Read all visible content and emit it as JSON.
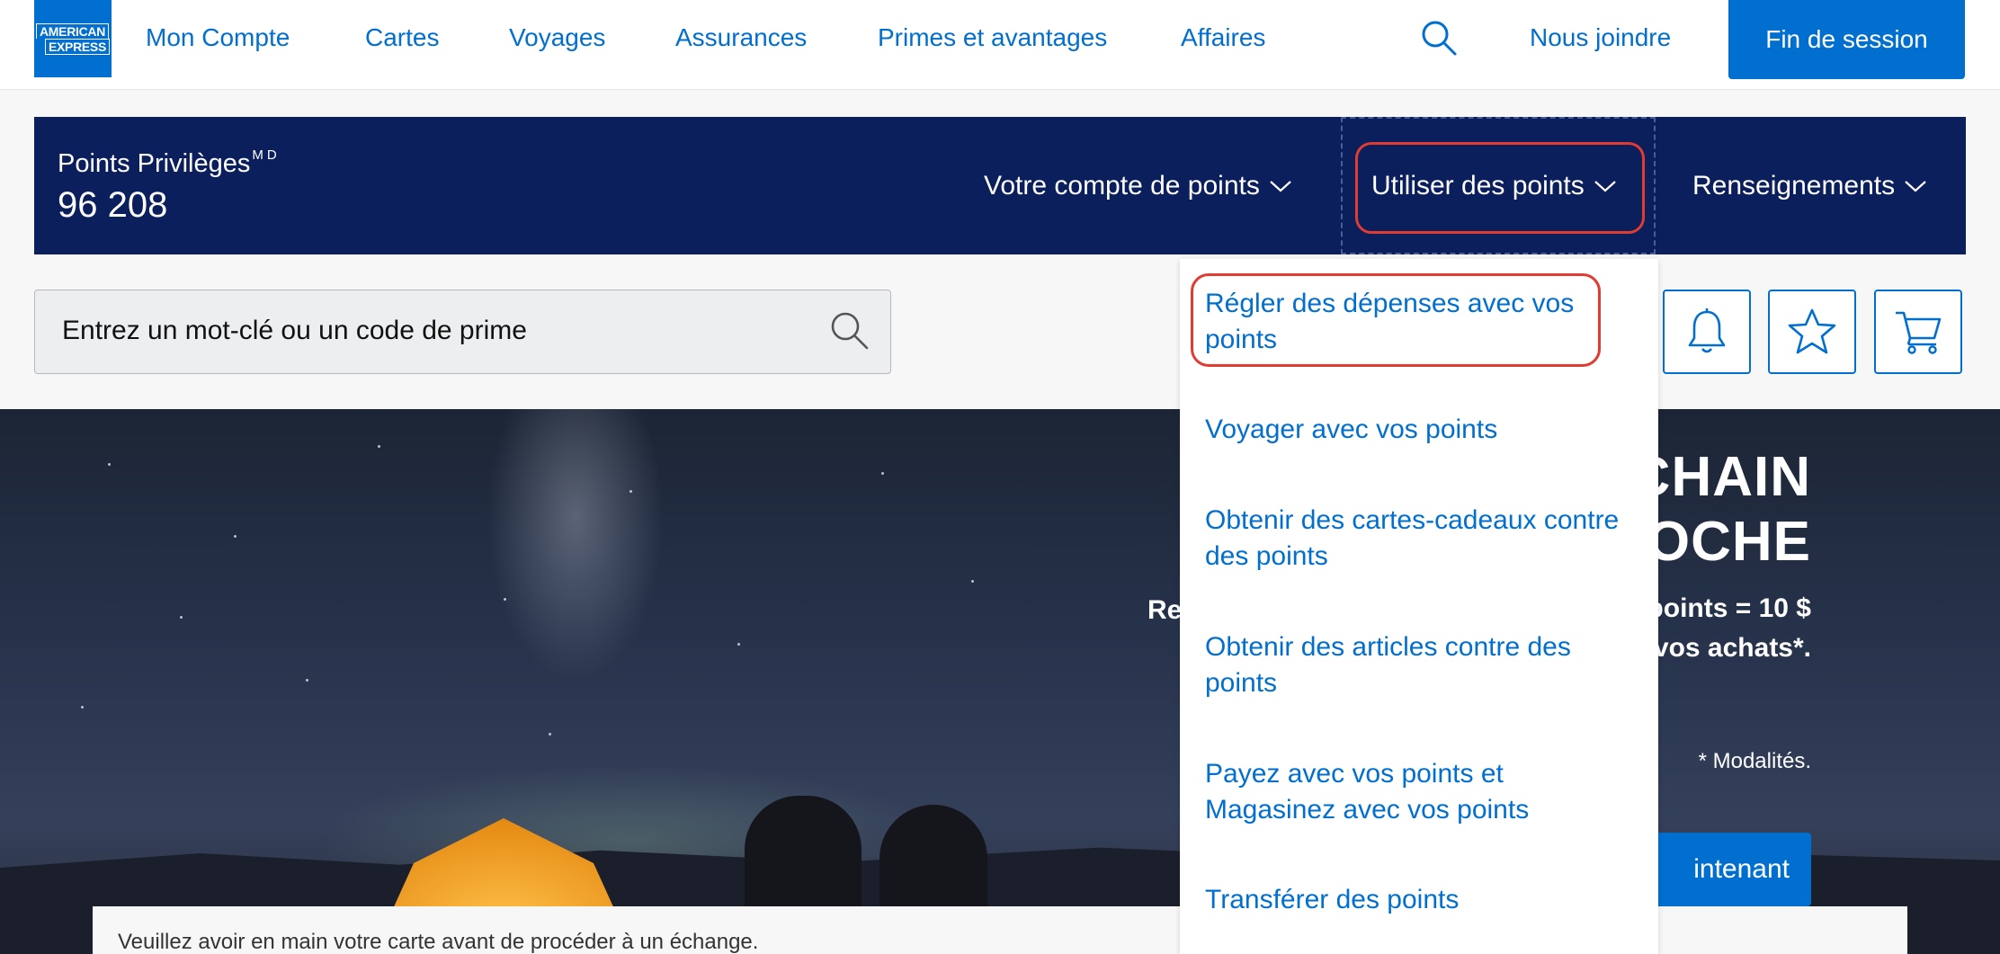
{
  "topnav": {
    "logo_line1": "AMERICAN",
    "logo_line2": "EXPRESS",
    "items": [
      "Mon Compte",
      "Cartes",
      "Voyages",
      "Assurances",
      "Primes et avantages",
      "Affaires"
    ],
    "contact": "Nous joindre",
    "logout": "Fin de session",
    "search_icon": "search-icon"
  },
  "points_bar": {
    "label": "Points Privilèges",
    "label_sup": "MD",
    "value": "96 208",
    "menus": [
      "Votre compte de points",
      "Utiliser des points",
      "Renseignements"
    ],
    "highlighted_menu": "Utiliser des points"
  },
  "search": {
    "placeholder": "Entrez un mot-clé ou un code de prime"
  },
  "toolbar_icons": [
    "bell-icon",
    "star-icon",
    "cart-icon"
  ],
  "dropdown": {
    "items": [
      "Régler des dépenses avec vos points",
      "Voyager avec vos points",
      "Obtenir des cartes-cadeaux contre des points",
      "Obtenir des articles contre des points",
      "Payez avec vos points et Magasinez avec vos points",
      "Transférer des points"
    ],
    "highlighted_item": "Régler des dépenses avec vos points"
  },
  "hero": {
    "title_line1": "CHAIN",
    "title_line2": "OCHE",
    "sub_left": "Re",
    "sub_line1": "points = 10 $",
    "sub_line2": "vos achats*.",
    "modalites": "* Modalités.",
    "cta": "intenant"
  },
  "notice": "Veuillez avoir en main votre carte avant de procéder à un échange.",
  "colors": {
    "brand_blue": "#006fcf",
    "bar_navy": "#0b1f5d",
    "highlight_red": "#e03c31"
  }
}
